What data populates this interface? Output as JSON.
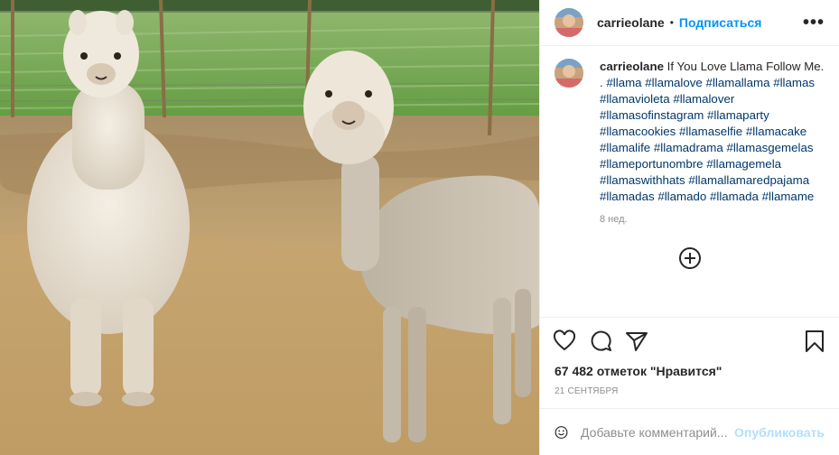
{
  "post": {
    "username": "carrieolane",
    "follow_label": "Подписаться",
    "separator": "•",
    "more_label": "•••",
    "caption_user": "carrieolane",
    "caption_text": " If You Love Llama Follow Me. . ",
    "hashtags": [
      "#llama",
      "#llamalove",
      "#llamallama",
      "#llamas",
      "#llamavioleta",
      "#llamalover",
      "#llamasofinstagram",
      "#llamaparty",
      "#llamacookies",
      "#llamaselfie",
      "#llamacake",
      "#llamalife",
      "#llamadrama",
      "#llamasgemelas",
      "#llameportunombre",
      "#llamagemela",
      "#llamaswithhats",
      "#llamallamaredpajama",
      "#llamadas",
      "#llamado",
      "#llamada",
      "#llamame"
    ],
    "time_ago": "8 нед.",
    "likes": "67 482 отметок \"Нравится\"",
    "date": "21 СЕНТЯБРЯ",
    "comment_placeholder": "Добавьте комментарий...",
    "publish_label": "Опубликовать"
  },
  "icons": {
    "more": "more-options-icon",
    "add_comment": "plus-circle-icon",
    "like": "heart-icon",
    "comment": "comment-bubble-icon",
    "share": "paper-plane-icon",
    "save": "bookmark-icon",
    "emoji": "smiley-icon"
  },
  "colors": {
    "link": "#0095f6",
    "hashtag": "#00376b",
    "muted": "#8e8e8e",
    "publish_disabled": "#b2dffc"
  }
}
